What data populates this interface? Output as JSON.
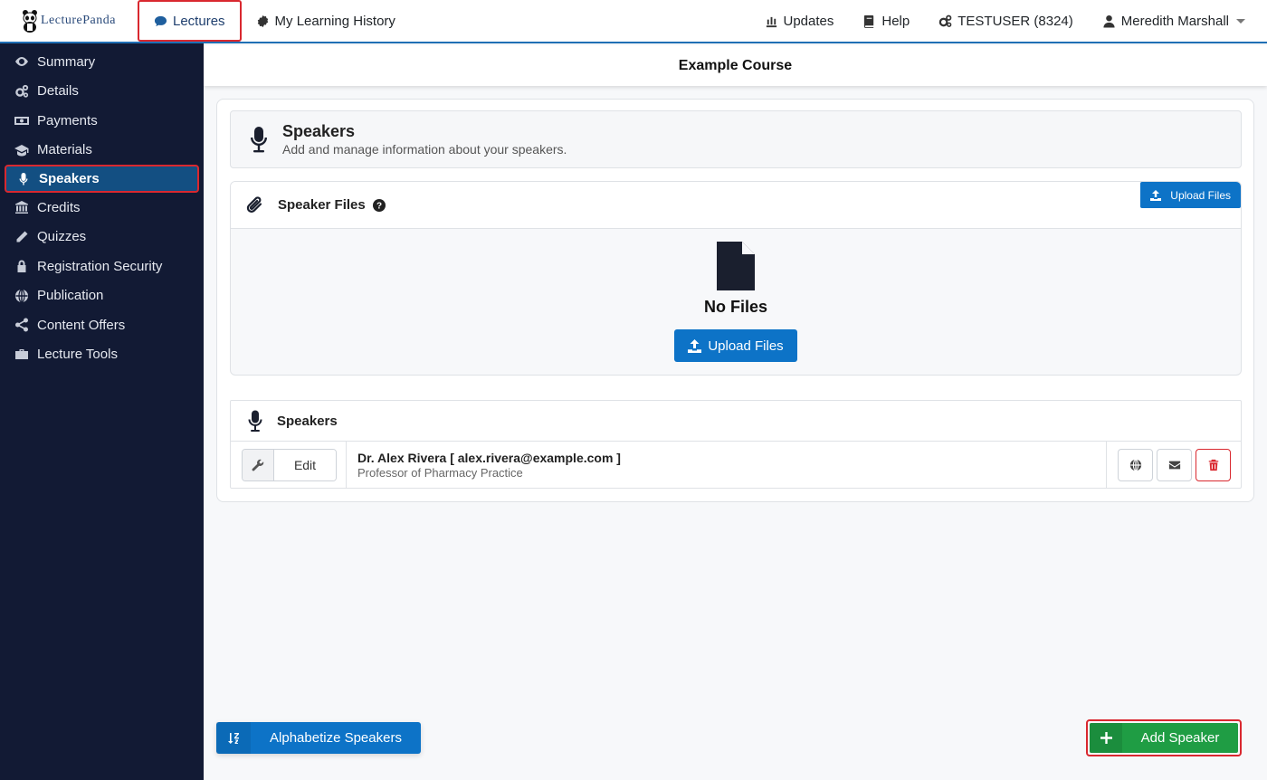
{
  "brand": {
    "logo_text": "LecturePanda"
  },
  "topnav": {
    "left": [
      {
        "label": "Lectures",
        "icon": "comment-icon"
      },
      {
        "label": "My Learning History",
        "icon": "certificate-icon"
      }
    ],
    "right": [
      {
        "label": "Updates",
        "icon": "updates-icon"
      },
      {
        "label": "Help",
        "icon": "book-icon"
      },
      {
        "label": "TESTUSER (8324)",
        "icon": "gears-icon"
      },
      {
        "label": "Meredith Marshall",
        "icon": "user-icon"
      }
    ]
  },
  "sidebar": {
    "items": [
      {
        "label": "Summary",
        "icon": "eye-icon"
      },
      {
        "label": "Details",
        "icon": "gears-icon"
      },
      {
        "label": "Payments",
        "icon": "money-icon"
      },
      {
        "label": "Materials",
        "icon": "graduation-cap-icon"
      },
      {
        "label": "Speakers",
        "icon": "microphone-icon",
        "active": true
      },
      {
        "label": "Credits",
        "icon": "bank-icon"
      },
      {
        "label": "Quizzes",
        "icon": "pencil-icon"
      },
      {
        "label": "Registration Security",
        "icon": "lock-icon"
      },
      {
        "label": "Publication",
        "icon": "globe-icon"
      },
      {
        "label": "Content Offers",
        "icon": "share-icon"
      },
      {
        "label": "Lecture Tools",
        "icon": "briefcase-icon"
      }
    ]
  },
  "course": {
    "title": "Example Course"
  },
  "speakers_header": {
    "title": "Speakers",
    "subtitle": "Add and manage information about your speakers."
  },
  "speaker_files": {
    "title": "Speaker Files",
    "upload_small_label": "Upload Files",
    "empty_text": "No Files",
    "upload_label": "Upload Files"
  },
  "speakers_list": {
    "title": "Speakers",
    "rows": [
      {
        "edit_label": "Edit",
        "name_line": "Dr. Alex Rivera [ alex.rivera@example.com ]",
        "role": "Professor of Pharmacy Practice"
      }
    ]
  },
  "footer_actions": {
    "alphabetize_label": "Alphabetize Speakers",
    "add_label": "Add Speaker"
  },
  "colors": {
    "primary": "#0d73c7",
    "sidebar_bg": "#121a34",
    "sidebar_active": "#134f82",
    "success": "#1f9d44",
    "highlight": "#d9282f"
  }
}
